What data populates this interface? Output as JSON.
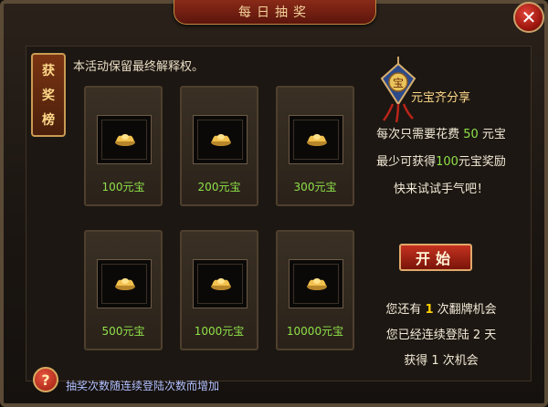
{
  "window": {
    "title": "每日抽奖",
    "close_label": "✕"
  },
  "ranking_tab": {
    "chars": [
      "获",
      "奖",
      "榜"
    ]
  },
  "notice": "本活动保留最终解释权。",
  "rewards": [
    {
      "amount": "100元宝"
    },
    {
      "amount": "200元宝"
    },
    {
      "amount": "300元宝"
    },
    {
      "amount": "500元宝"
    },
    {
      "amount": "1000元宝"
    },
    {
      "amount": "10000元宝"
    }
  ],
  "share": {
    "badge_char": "宝",
    "title": "元宝齐分享"
  },
  "info": {
    "cost_prefix": "每次只需要花费",
    "cost_value": "50",
    "cost_suffix": "元宝",
    "gain_prefix": "最少可获得",
    "gain_value": "100",
    "gain_suffix": "元宝奖励",
    "try_luck": "快来试试手气吧！",
    "remaining_prefix": "您还有",
    "remaining_value": "1",
    "remaining_suffix": "次翻牌机会",
    "login_line": "您已经连续登陆 2 天",
    "obtained_line": "获得 1 次机会"
  },
  "start_label": "开始",
  "help": {
    "icon": "?",
    "text": "抽奖次数随连续登陆次数而增加"
  },
  "colors": {
    "accent": "#8fe14a",
    "gold": "#ffd98a",
    "frame": "#5a4a36"
  }
}
